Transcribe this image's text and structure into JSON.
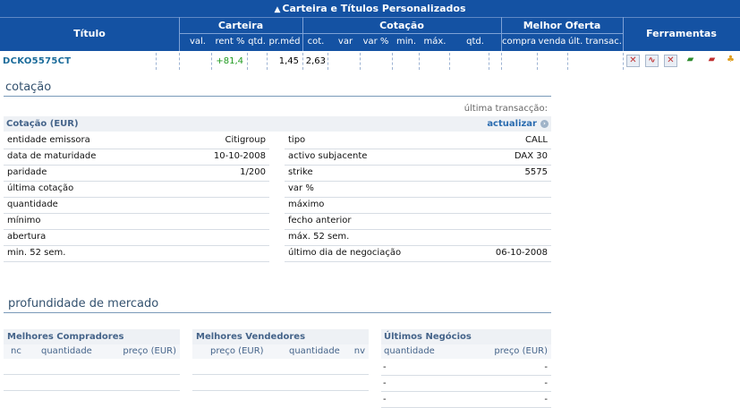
{
  "portfolio": {
    "title": "Carteira e Títulos Personalizados",
    "title_icon": "triangle-up",
    "col_titulo": "Título",
    "group_carteira": "Carteira",
    "group_cotacao": "Cotação",
    "group_melhor_oferta": "Melhor Oferta",
    "col_ferramentas": "Ferramentas",
    "sub": {
      "val": "val.",
      "rent": "rent %",
      "qtd": "qtd.",
      "prmed": "pr.méd",
      "cot": "cot.",
      "var": "var",
      "varp": "var %",
      "min": "min.",
      "max": "máx.",
      "qtd2": "qtd.",
      "compra": "compra",
      "venda": "venda",
      "ult": "últ. transac."
    },
    "row": {
      "ticker": "DCKO5575CT",
      "rent": "+81,4",
      "prmed": "1,45",
      "cot": "2,63"
    },
    "tool_icons": [
      "remove-icon",
      "chart-icon",
      "delete-icon",
      "folder-add-icon",
      "folder-move-icon",
      "alert-bell-icon"
    ],
    "colors": {
      "header_bg": "#1452a3",
      "positive": "#1f9a1f",
      "section_title": "#34526f",
      "link": "#2b6cb0"
    }
  },
  "cotacao": {
    "section_title": "cotação",
    "ultima_transaccao_label": "última transacção:",
    "box_title": "Cotação (EUR)",
    "refresh_label": "actualizar",
    "left": [
      {
        "label": "entidade emissora",
        "value": "Citigroup"
      },
      {
        "label": "data de maturidade",
        "value": "10-10-2008"
      },
      {
        "label": "paridade",
        "value": "1/200"
      },
      {
        "label": "última cotação",
        "value": ""
      },
      {
        "label": "quantidade",
        "value": ""
      },
      {
        "label": "mínimo",
        "value": ""
      },
      {
        "label": "abertura",
        "value": ""
      },
      {
        "label": "min. 52 sem.",
        "value": ""
      }
    ],
    "right": [
      {
        "label": "tipo",
        "value": "CALL"
      },
      {
        "label": "activo subjacente",
        "value": "DAX 30"
      },
      {
        "label": "strike",
        "value": "5575"
      },
      {
        "label": "var %",
        "value": ""
      },
      {
        "label": "máximo",
        "value": ""
      },
      {
        "label": "fecho anterior",
        "value": ""
      },
      {
        "label": "máx. 52 sem.",
        "value": ""
      },
      {
        "label": "último dia de negociação",
        "value": "06-10-2008"
      }
    ]
  },
  "depth": {
    "section_title": "profundidade de mercado",
    "buyers": {
      "title": "Melhores Compradores",
      "c1": "nc",
      "c2": "quantidade",
      "c3": "preço (EUR)"
    },
    "sellers": {
      "title": "Melhores Vendedores",
      "c1": "preço (EUR)",
      "c2": "quantidade",
      "c3": "nv"
    },
    "trades": {
      "title": "Últimos Negócios",
      "c1": "quantidade",
      "c2": "preço (EUR)",
      "rows": [
        {
          "q": "-",
          "p": "-"
        },
        {
          "q": "-",
          "p": "-"
        },
        {
          "q": "-",
          "p": "-"
        }
      ]
    }
  }
}
